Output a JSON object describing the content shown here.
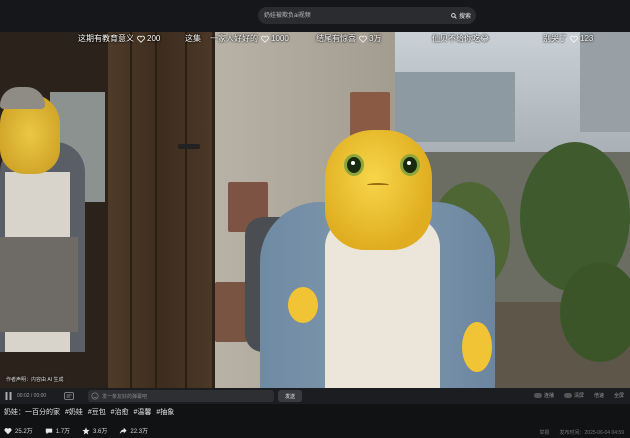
{
  "search": {
    "placeholder": "奶娃被欺负ai视频",
    "button_label": "搜索"
  },
  "danmaku": [
    {
      "text": "这期有教育意义",
      "likes": "200"
    },
    {
      "text": "这集",
      "likes": ""
    },
    {
      "text": "一家人好好的",
      "likes": "1000"
    },
    {
      "text": "结尾有惊喜",
      "likes": "3万"
    },
    {
      "text": "仙贝不给你吃😂",
      "likes": ""
    },
    {
      "text": "别哭了",
      "likes": "123"
    }
  ],
  "video": {
    "overlay_label": "作者声明：内容由 AI 生成"
  },
  "controls": {
    "time": "00:02 / 00:00",
    "danmaku_placeholder": "发一条友好的弹幕吧",
    "send_label": "发送",
    "right_labels": [
      "连播",
      "清屏",
      "倍速",
      "全屏"
    ]
  },
  "caption": {
    "title": "奶娃：一百分的家",
    "tags": [
      "#奶娃",
      "#豆包",
      "#治愈",
      "#温馨",
      "#抽象"
    ]
  },
  "stats": {
    "likes": "25.2万",
    "comments": "1.7万",
    "favorites": "3.6万",
    "shares": "22.3万"
  },
  "meta": {
    "report": "举报",
    "date": "发布时间：2025-06-04 04:59"
  }
}
